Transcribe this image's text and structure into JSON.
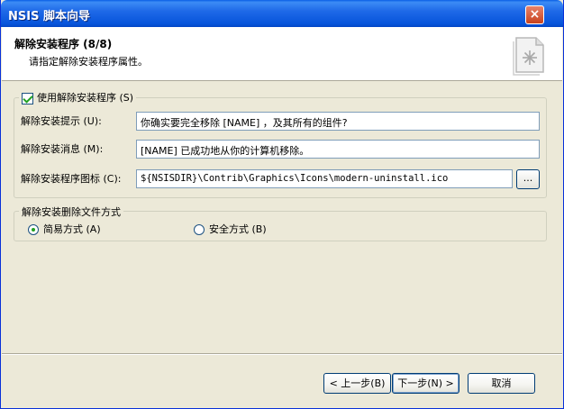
{
  "window": {
    "title": "NSIS 脚本向导",
    "close_glyph": "×"
  },
  "header": {
    "title": "解除安装程序 (8/8)",
    "subtitle": "请指定解除安装程序属性。",
    "icon": "document-installer-icon"
  },
  "uninstaller_group": {
    "checkbox_label": "使用解除安装程序 (S)",
    "checked": true,
    "fields": [
      {
        "label": "解除安装提示 (U):",
        "value": "你确实要完全移除 [NAME] ，及其所有的组件?"
      },
      {
        "label": "解除安装消息 (M):",
        "value": "[NAME] 已成功地从你的计算机移除。"
      },
      {
        "label": "解除安装程序图标 (C):",
        "value": "${NSISDIR}\\Contrib\\Graphics\\Icons\\modern-uninstall.ico"
      }
    ],
    "browse_label": "..."
  },
  "delete_group": {
    "legend": "解除安装删除文件方式",
    "options": [
      {
        "label": "简易方式 (A)",
        "selected": true
      },
      {
        "label": "安全方式 (B)",
        "selected": false
      }
    ]
  },
  "buttons": {
    "back": "< 上一步(B)",
    "next": "下一步(N) >",
    "cancel": "取消"
  }
}
